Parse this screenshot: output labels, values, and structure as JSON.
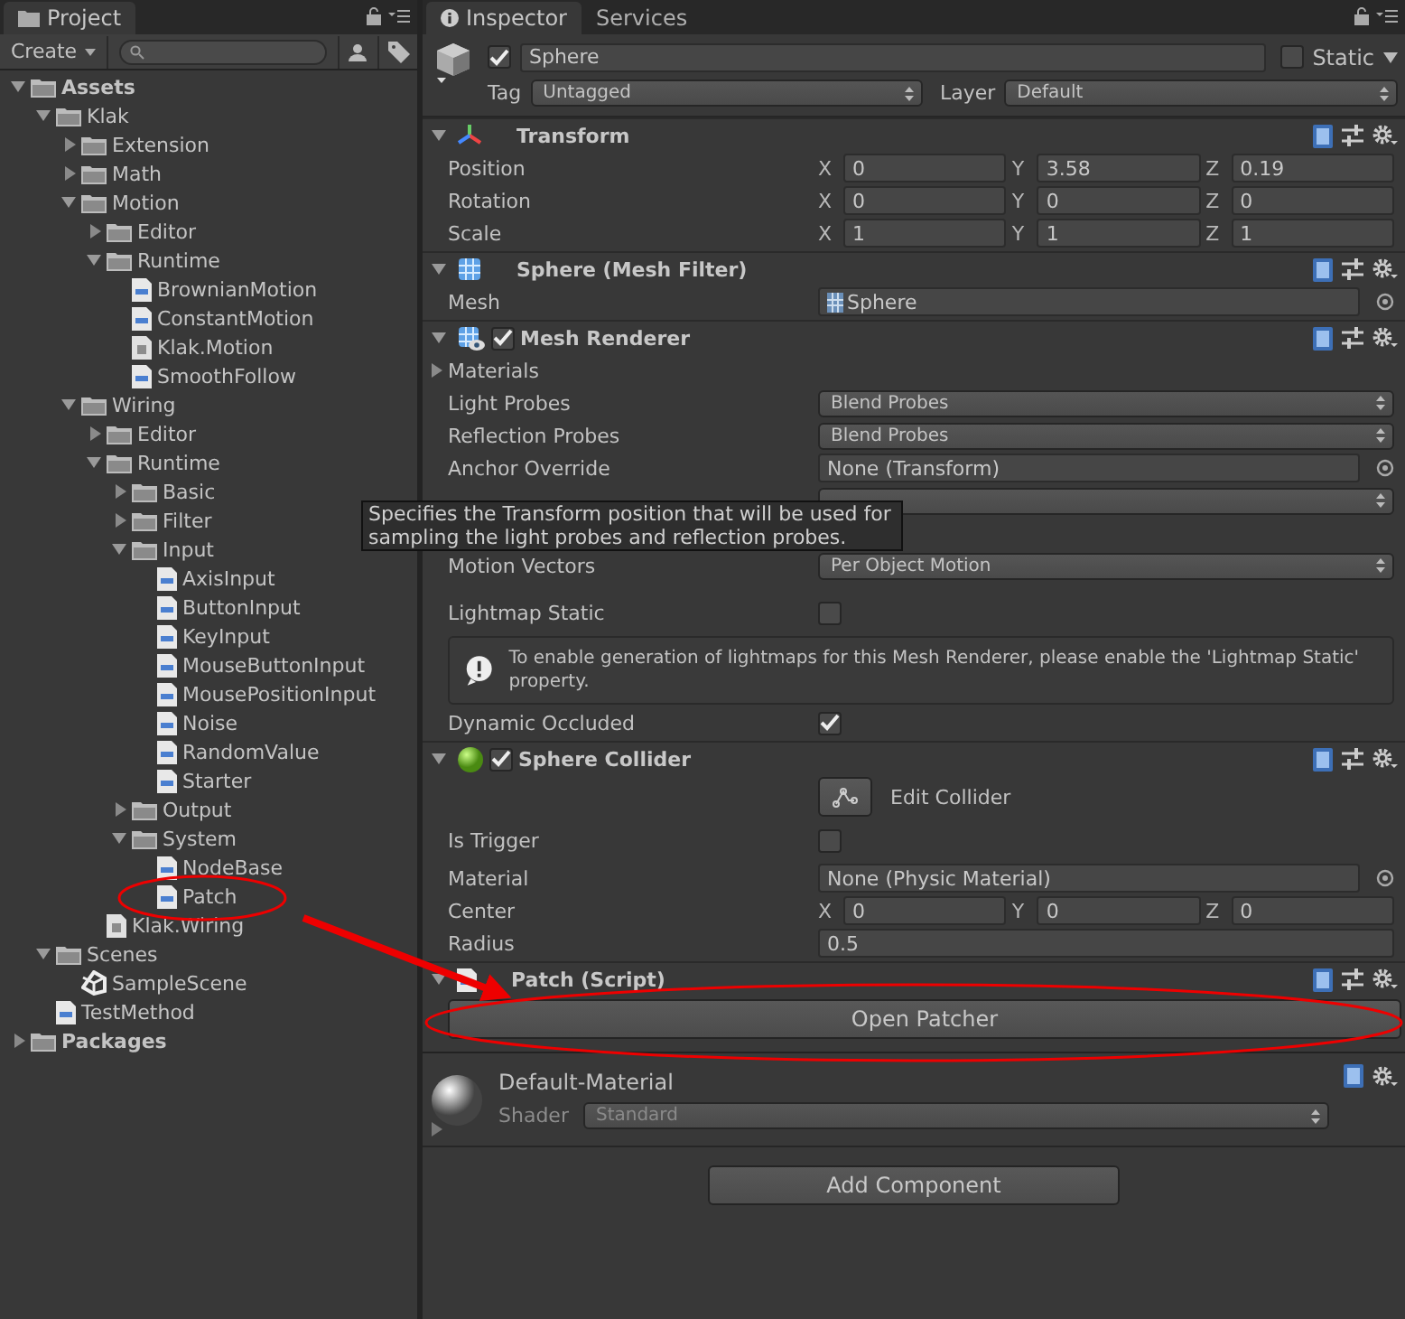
{
  "project_panel": {
    "tab": "Project",
    "create_button": "Create",
    "tree": [
      {
        "label": "Assets",
        "kind": "folder",
        "expanded": true,
        "children": [
          {
            "label": "Klak",
            "kind": "folder",
            "expanded": true,
            "children": [
              {
                "label": "Extension",
                "kind": "folder",
                "expanded": false
              },
              {
                "label": "Math",
                "kind": "folder",
                "expanded": false
              },
              {
                "label": "Motion",
                "kind": "folder",
                "expanded": true,
                "children": [
                  {
                    "label": "Editor",
                    "kind": "folder",
                    "expanded": false
                  },
                  {
                    "label": "Runtime",
                    "kind": "folder",
                    "expanded": true,
                    "children": [
                      {
                        "label": "BrownianMotion",
                        "kind": "script"
                      },
                      {
                        "label": "ConstantMotion",
                        "kind": "script"
                      },
                      {
                        "label": "Klak.Motion",
                        "kind": "assembly"
                      },
                      {
                        "label": "SmoothFollow",
                        "kind": "script"
                      }
                    ]
                  }
                ]
              },
              {
                "label": "Wiring",
                "kind": "folder",
                "expanded": true,
                "children": [
                  {
                    "label": "Editor",
                    "kind": "folder",
                    "expanded": false
                  },
                  {
                    "label": "Runtime",
                    "kind": "folder",
                    "expanded": true,
                    "children": [
                      {
                        "label": "Basic",
                        "kind": "folder",
                        "expanded": false
                      },
                      {
                        "label": "Filter",
                        "kind": "folder",
                        "expanded": false
                      },
                      {
                        "label": "Input",
                        "kind": "folder",
                        "expanded": true,
                        "children": [
                          {
                            "label": "AxisInput",
                            "kind": "script"
                          },
                          {
                            "label": "ButtonInput",
                            "kind": "script"
                          },
                          {
                            "label": "KeyInput",
                            "kind": "script"
                          },
                          {
                            "label": "MouseButtonInput",
                            "kind": "script"
                          },
                          {
                            "label": "MousePositionInput",
                            "kind": "script"
                          },
                          {
                            "label": "Noise",
                            "kind": "script"
                          },
                          {
                            "label": "RandomValue",
                            "kind": "script"
                          },
                          {
                            "label": "Starter",
                            "kind": "script"
                          }
                        ]
                      },
                      {
                        "label": "Output",
                        "kind": "folder",
                        "expanded": false
                      },
                      {
                        "label": "System",
                        "kind": "folder",
                        "expanded": true,
                        "children": [
                          {
                            "label": "NodeBase",
                            "kind": "script"
                          },
                          {
                            "label": "Patch",
                            "kind": "script"
                          }
                        ]
                      }
                    ]
                  },
                  {
                    "label": "Klak.Wiring",
                    "kind": "assembly"
                  }
                ]
              }
            ]
          },
          {
            "label": "Scenes",
            "kind": "folder",
            "expanded": true,
            "children": [
              {
                "label": "SampleScene",
                "kind": "scene"
              }
            ]
          },
          {
            "label": "TestMethod",
            "kind": "script"
          }
        ]
      },
      {
        "label": "Packages",
        "kind": "folder",
        "expanded": false
      }
    ]
  },
  "inspector": {
    "tabs": [
      {
        "label": "Inspector",
        "selected": true
      },
      {
        "label": "Services",
        "selected": false
      }
    ],
    "object": {
      "active": true,
      "name": "Sphere",
      "static": false,
      "static_label": "Static",
      "tag_label": "Tag",
      "tag": "Untagged",
      "layer_label": "Layer",
      "layer": "Default"
    },
    "components": [
      {
        "title": "Transform",
        "kind": "transform",
        "rows": [
          {
            "kind": "vector",
            "label": "Position",
            "fields": [
              {
                "axis": "X",
                "value": "0"
              },
              {
                "axis": "Y",
                "value": "3.58"
              },
              {
                "axis": "Z",
                "value": "0.19"
              }
            ]
          },
          {
            "kind": "vector",
            "label": "Rotation",
            "fields": [
              {
                "axis": "X",
                "value": "0"
              },
              {
                "axis": "Y",
                "value": "0"
              },
              {
                "axis": "Z",
                "value": "0"
              }
            ]
          },
          {
            "kind": "vector",
            "label": "Scale",
            "fields": [
              {
                "axis": "X",
                "value": "1"
              },
              {
                "axis": "Y",
                "value": "1"
              },
              {
                "axis": "Z",
                "value": "1"
              }
            ]
          }
        ]
      },
      {
        "title": "Sphere (Mesh Filter)",
        "kind": "mesh",
        "rows": [
          {
            "kind": "object",
            "label": "Mesh",
            "value": "Sphere",
            "asset_icon": true
          }
        ]
      },
      {
        "title": "Mesh Renderer",
        "kind": "renderer",
        "enabled": true,
        "rows": [
          {
            "kind": "foldout",
            "label": "Materials",
            "expanded": false
          },
          {
            "kind": "dropdown",
            "label": "Light Probes",
            "value": "Blend Probes"
          },
          {
            "kind": "dropdown",
            "label": "Reflection Probes",
            "value": "Blend Probes"
          },
          {
            "kind": "object",
            "label": "Anchor Override",
            "value": "None (Transform)",
            "asset_icon": false
          },
          {
            "kind": "covered_dropdown"
          },
          {
            "kind": "spacer"
          },
          {
            "kind": "dropdown",
            "label": "Motion Vectors",
            "value": "Per Object Motion"
          },
          {
            "kind": "checkbox",
            "label": "Lightmap Static",
            "checked": false
          },
          {
            "kind": "help",
            "text": "To enable generation of lightmaps for this Mesh Renderer, please enable the 'Lightmap Static' property."
          },
          {
            "kind": "checkbox",
            "label": "Dynamic Occluded",
            "checked": true
          }
        ]
      },
      {
        "title": "Sphere Collider",
        "kind": "collider",
        "enabled": true,
        "rows": [
          {
            "kind": "tool",
            "label": "Edit Collider"
          },
          {
            "kind": "checkbox",
            "label": "Is Trigger",
            "checked": false
          },
          {
            "kind": "object",
            "label": "Material",
            "value": "None (Physic Material)",
            "asset_icon": false
          },
          {
            "kind": "vector",
            "label": "Center",
            "fields": [
              {
                "axis": "X",
                "value": "0"
              },
              {
                "axis": "Y",
                "value": "0"
              },
              {
                "axis": "Z",
                "value": "0"
              }
            ]
          },
          {
            "kind": "field",
            "label": "Radius",
            "value": "0.5"
          }
        ]
      },
      {
        "title": "Patch (Script)",
        "kind": "script",
        "rows": [
          {
            "kind": "button",
            "label": "Open Patcher"
          }
        ]
      }
    ],
    "material": {
      "name": "Default-Material",
      "shader_label": "Shader",
      "shader": "Standard"
    },
    "add_component": "Add Component",
    "tooltip": "Specifies the Transform position that will be used for sampling the light probes and reflection probes."
  }
}
